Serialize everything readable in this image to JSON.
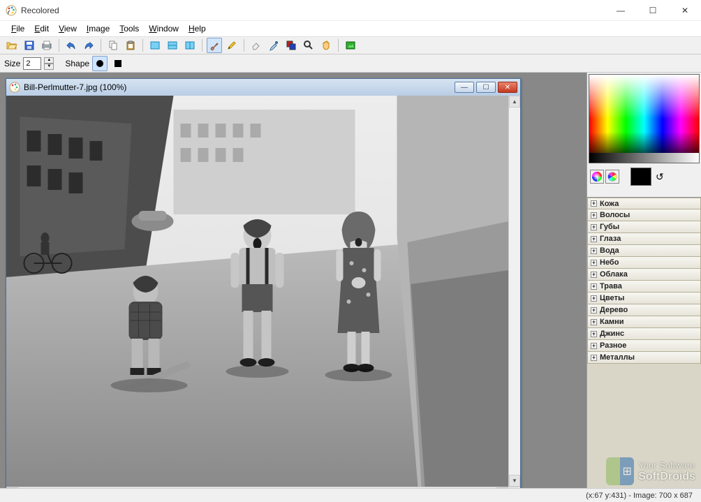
{
  "window": {
    "title": "Recolored",
    "buttons": {
      "min": "—",
      "max": "☐",
      "close": "✕"
    }
  },
  "menu": {
    "file": "File",
    "edit": "Edit",
    "view": "View",
    "image": "Image",
    "tools": "Tools",
    "window": "Window",
    "help": "Help"
  },
  "toolbar2": {
    "size_label": "Size",
    "size_value": "2",
    "shape_label": "Shape"
  },
  "document": {
    "title": "Bill-Perlmutter-7.jpg (100%)"
  },
  "palette": {
    "items": [
      "Кожа",
      "Волосы",
      "Губы",
      "Глаза",
      "Вода",
      "Небо",
      "Облака",
      "Трава",
      "Цветы",
      "Дерево",
      "Камни",
      "Джинс",
      "Разное",
      "Металлы"
    ]
  },
  "status": {
    "text": "(x:67 y:431) - Image: 700 x 687"
  },
  "watermark": {
    "line1": "Your Software",
    "line2": "SoftDroids"
  },
  "colors": {
    "current": "#000000"
  }
}
